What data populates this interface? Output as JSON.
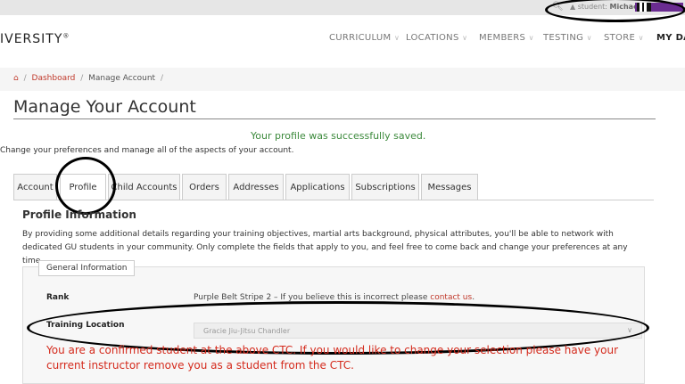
{
  "topbar": {
    "search_icon": "search-icon",
    "user_icon": "user-icon",
    "user_prefix": "student:",
    "user_name": "Michael",
    "belt_color": "#6a2c91"
  },
  "logo": {
    "text": "IVERSITY",
    "reg": "®"
  },
  "nav": {
    "items": [
      "CURRICULUM",
      "LOCATIONS",
      "MEMBERS",
      "TESTING",
      "STORE"
    ],
    "last": "MY DAS"
  },
  "breadcrumb": {
    "home_icon": "home-icon",
    "dashboard": "Dashboard",
    "current": "Manage Account"
  },
  "page": {
    "title": "Manage Your Account",
    "saved_message": "Your profile was successfully saved.",
    "subtitle": "Change your preferences and manage all of the aspects of your account."
  },
  "tabs": [
    "Account",
    "Profile",
    "Child Accounts",
    "Orders",
    "Addresses",
    "Applications",
    "Subscriptions",
    "Messages"
  ],
  "active_tab": "Profile",
  "profile": {
    "heading": "Profile Information",
    "description": "By providing some additional details regarding your training objectives, martial arts background, physical attributes, you'll be able to network with dedicated GU students in your community. Only complete the fields that apply to you, and feel free to come back and change your preferences at any time.",
    "fieldset_legend": "General Information",
    "rank_label": "Rank",
    "rank_value": "Purple Belt Stripe 2 – If you believe this is incorrect please",
    "rank_link": "contact us",
    "rank_end": ".",
    "location_label": "Training Location",
    "location_value": "Gracie Jiu-Jitsu Chandler",
    "warning": "You are a confirmed student at the above CTC. If you would like to change your selection please have your current instructor remove you as a student from the CTC."
  }
}
